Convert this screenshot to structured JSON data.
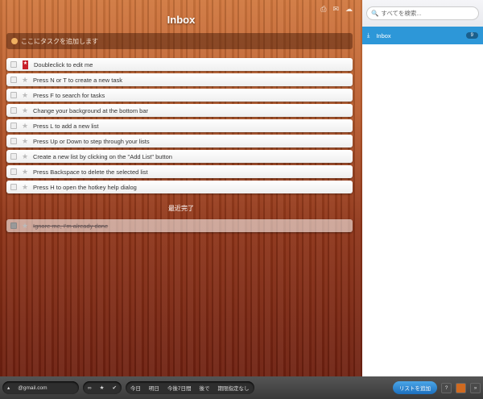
{
  "header": {
    "title": "Inbox",
    "icons": [
      "print-icon",
      "mail-icon",
      "cloud-icon"
    ]
  },
  "add_task": {
    "placeholder": "ここにタスクを追加します"
  },
  "tasks": [
    {
      "text": "Doubleclick to edit me",
      "starred": true
    },
    {
      "text": "Press N or T to create a new task",
      "starred": false
    },
    {
      "text": "Press F to search for tasks",
      "starred": false
    },
    {
      "text": "Change your background at the bottom bar",
      "starred": false
    },
    {
      "text": "Press L to add a new list",
      "starred": false
    },
    {
      "text": "Press Up or Down to step through your lists",
      "starred": false
    },
    {
      "text": "Create a new list by clicking on the \"Add List\" button",
      "starred": false
    },
    {
      "text": "Press Backspace to delete the selected list",
      "starred": false
    },
    {
      "text": "Press H to open the hotkey help dialog",
      "starred": false
    }
  ],
  "completed": {
    "heading": "最近完了",
    "items": [
      {
        "text": "Ignore me, I'm already done"
      }
    ]
  },
  "sidebar": {
    "search_placeholder": "すべてを検索...",
    "lists": [
      {
        "name": "Inbox",
        "count": "9"
      }
    ]
  },
  "bottom": {
    "account": "@gmail.com",
    "filters": [
      "今日",
      "明日",
      "今後7日間",
      "後で",
      "期限指定なし"
    ],
    "add_list": "リストを追加",
    "help": "?"
  }
}
